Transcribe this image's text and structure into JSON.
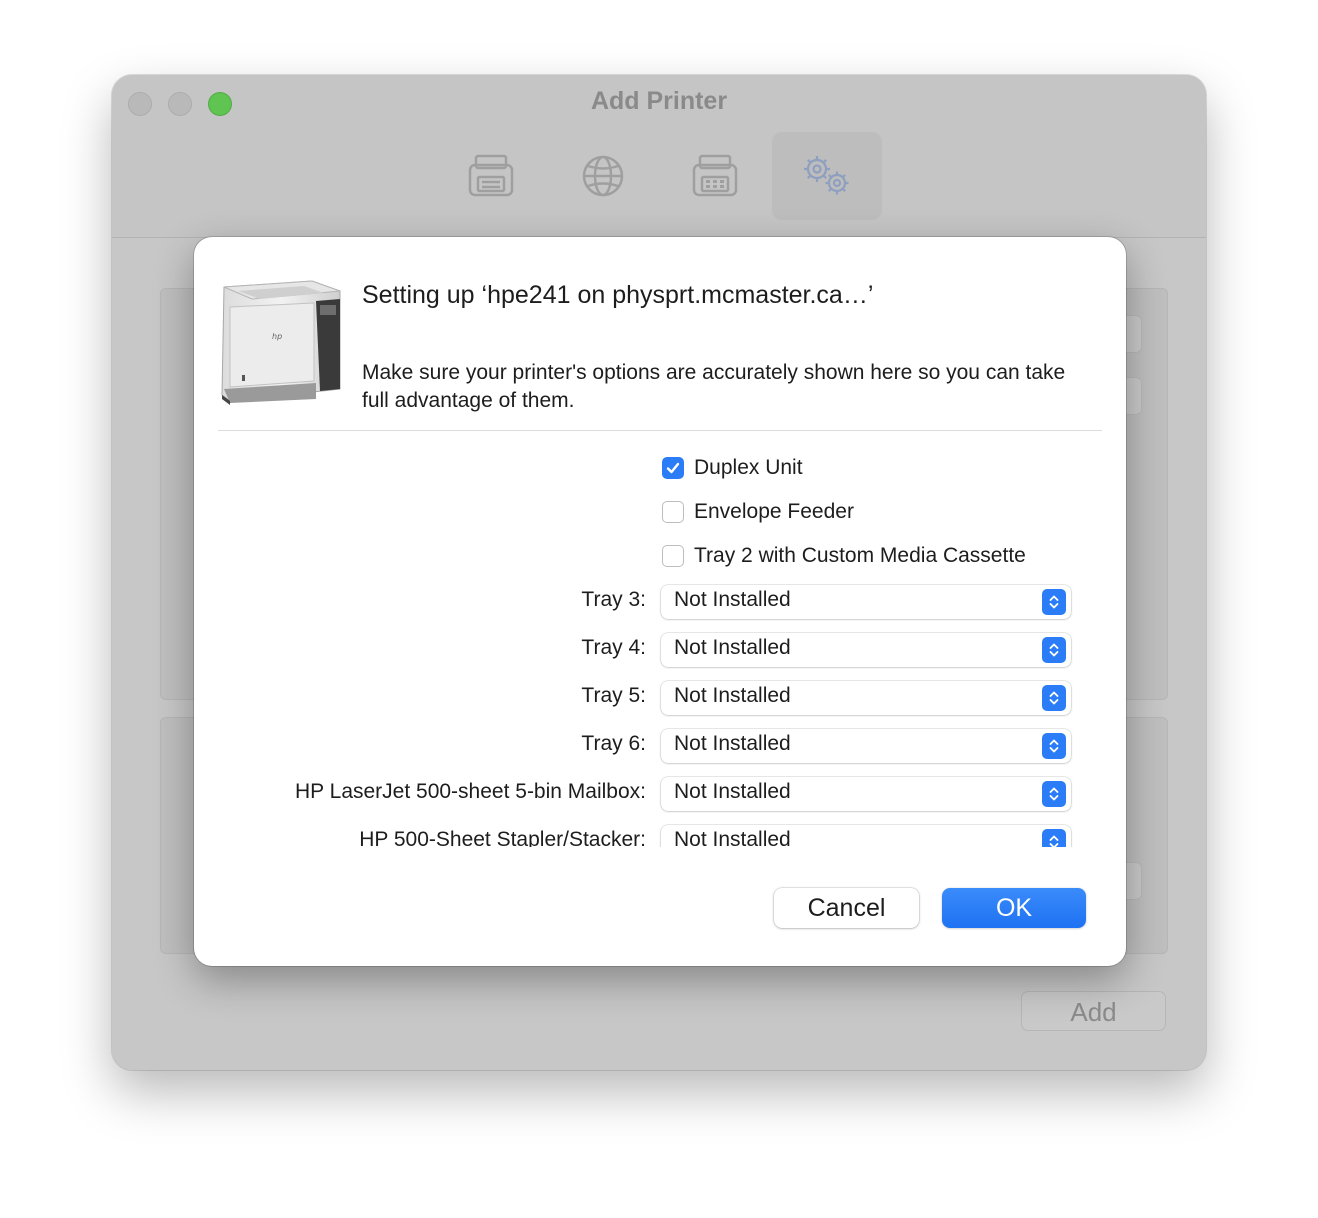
{
  "window": {
    "title": "Add Printer"
  },
  "toolbar": {
    "buttons": [
      {
        "icon": "printer-icon",
        "selected": false
      },
      {
        "icon": "globe-icon",
        "selected": false
      },
      {
        "icon": "fax-printer-icon",
        "selected": false
      },
      {
        "icon": "gears-icon",
        "selected": true
      }
    ]
  },
  "background": {
    "add_label": "Add"
  },
  "sheet": {
    "title": "Setting up ‘hpe241 on physprt.mcmaster.ca…’",
    "description": "Make sure your printer's options are accurately shown here so you can take full advantage of them.",
    "checkboxes": [
      {
        "label": "Duplex Unit",
        "checked": true
      },
      {
        "label": "Envelope Feeder",
        "checked": false
      },
      {
        "label": "Tray 2 with Custom Media Cassette",
        "checked": false
      }
    ],
    "popups": [
      {
        "label": "Tray 3:",
        "value": "Not Installed"
      },
      {
        "label": "Tray 4:",
        "value": "Not Installed"
      },
      {
        "label": "Tray 5:",
        "value": "Not Installed"
      },
      {
        "label": "Tray 6:",
        "value": "Not Installed"
      },
      {
        "label": "HP LaserJet 500-sheet 5-bin Mailbox:",
        "value": "Not Installed"
      },
      {
        "label": "HP 500-Sheet Stapler/Stacker:",
        "value": "Not Installed"
      }
    ],
    "cancel_label": "Cancel",
    "ok_label": "OK"
  },
  "colors": {
    "accent": "#2b7cf7",
    "zoom_button": "#5fc452"
  }
}
